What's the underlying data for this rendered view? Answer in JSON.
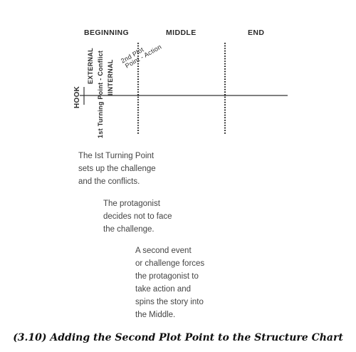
{
  "headers": {
    "beginning": "BEGINNING",
    "middle": "MIDDLE",
    "end": "END"
  },
  "labels": {
    "hook": "HOOK",
    "external": "EXTERNAL",
    "internal": "IINTERNAL",
    "first_turning_point": "1st Turning Point - Conflict",
    "second_plot_point_line1": "2nd Plot",
    "second_plot_point_line2": "Point - Action"
  },
  "notes": {
    "first": [
      "The Ist Turning Point",
      "sets up the challenge",
      "and the conflicts."
    ],
    "second": [
      "The protagonist",
      "decides not to face",
      "the challenge."
    ],
    "third": [
      "A second event",
      "or challenge forces",
      "the protagonist to",
      "take action and",
      "spins the story into",
      "the Middle."
    ]
  },
  "caption": "(3.10) Adding the Second Plot Point to the Structure Chart"
}
